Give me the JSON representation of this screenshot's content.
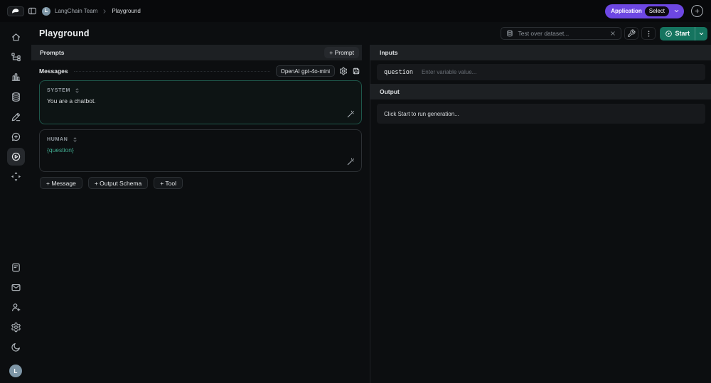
{
  "topnav": {
    "team": "LangChain Team",
    "page": "Playground",
    "application_label": "Application",
    "application_value": "Select"
  },
  "title": "Playground",
  "toolbar": {
    "dataset_placeholder": "Test over dataset...",
    "start_label": "Start"
  },
  "sidebar": {
    "top_icons": [
      "home",
      "trace-tree",
      "dashboard-chart",
      "datasets-database",
      "annotation-pen",
      "prompts-chat-plus",
      "playground-play",
      "deployments-arrows"
    ],
    "active_icon": "playground-play",
    "bottom_icons": [
      "docs-file",
      "mail-envelope",
      "invite-user-plus",
      "settings-gear",
      "dark-mode-moon"
    ],
    "avatar_letter": "L"
  },
  "prompts": {
    "header": "Prompts",
    "add_prompt_label": "+ Prompt"
  },
  "messages": {
    "header": "Messages",
    "model": "OpenAI gpt-4o-mini",
    "cards": [
      {
        "role": "SYSTEM",
        "text": "You are a chatbot."
      },
      {
        "role": "HUMAN",
        "text": "{question}"
      }
    ],
    "actions": [
      "+ Message",
      "+ Output Schema",
      "+ Tool"
    ]
  },
  "inputs": {
    "header": "Inputs",
    "variable": "question",
    "placeholder": "Enter variable value..."
  },
  "output": {
    "header": "Output",
    "empty_text": "Click Start to run generation..."
  },
  "colors": {
    "accent_purple": "#6d47e3",
    "start_green": "#15745f",
    "variable_teal": "#41ab90",
    "system_card_border": "#1e564a"
  }
}
